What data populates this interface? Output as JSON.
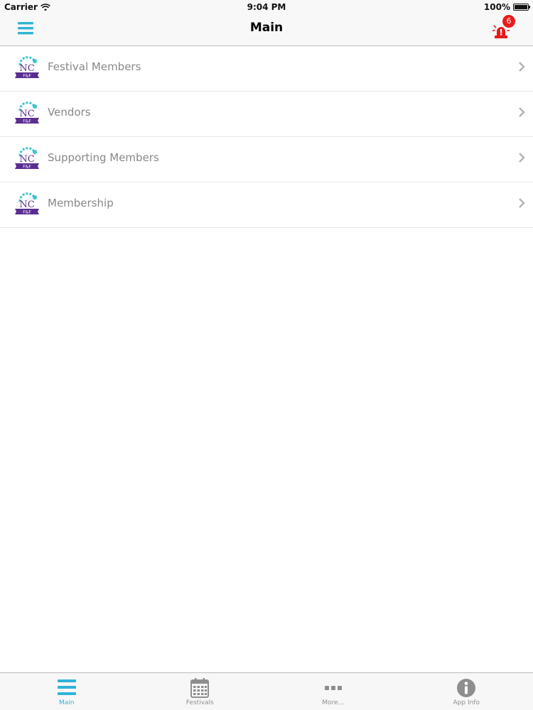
{
  "status_bar": {
    "carrier": "Carrier",
    "time": "9:04 PM",
    "battery": "100%",
    "icons": [
      "wifi-icon",
      "battery-icon"
    ]
  },
  "nav_bar": {
    "title": "Main",
    "left_icon": "menu-icon",
    "right_icon": "alert-siren-icon",
    "alert_count": "6"
  },
  "list": {
    "items": [
      {
        "label": "Festival Members",
        "icon": "ncfe-logo"
      },
      {
        "label": "Vendors",
        "icon": "ncfe-logo"
      },
      {
        "label": "Supporting Members",
        "icon": "ncfe-logo"
      },
      {
        "label": "Membership",
        "icon": "ncfe-logo"
      }
    ]
  },
  "tab_bar": {
    "tabs": [
      {
        "label": "Main",
        "icon": "menu-icon",
        "active": true
      },
      {
        "label": "Festivals",
        "icon": "calendar-icon",
        "active": false
      },
      {
        "label": "More...",
        "icon": "more-icon",
        "active": false
      },
      {
        "label": "App Info",
        "icon": "info-icon",
        "active": false
      }
    ]
  },
  "colors": {
    "accent": "#2fb3d9",
    "alert": "#e81b1b",
    "logo_purple": "#5a2d91",
    "logo_teal": "#3cc4d0",
    "list_text": "#888888"
  }
}
